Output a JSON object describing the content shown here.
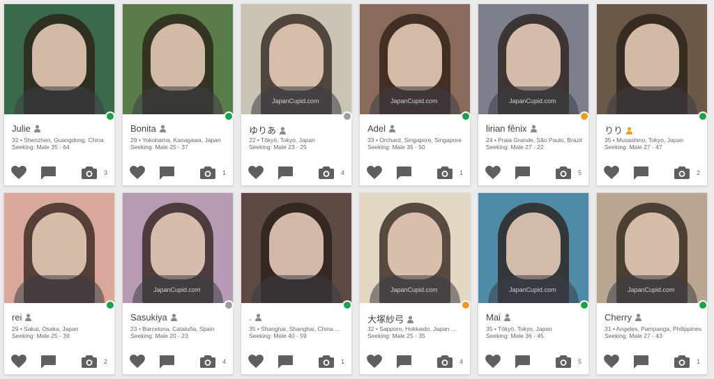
{
  "profiles": [
    {
      "name": "Julie",
      "location": "32 • Shenzhen, Guangdong, China",
      "seeking": "Seeking: Male 35 - 64",
      "photos": "3",
      "status": "online",
      "verified": false,
      "bg": "#3b6a4a",
      "watermark": ""
    },
    {
      "name": "Bonita",
      "location": "29 • Yokohama, Kanagawa, Japan",
      "seeking": "Seeking: Male 25 - 37",
      "photos": "1",
      "status": "online",
      "verified": false,
      "bg": "#5a7c48",
      "watermark": ""
    },
    {
      "name": "ゆりあ",
      "location": "22 • Tōkyō, Tokyo, Japan",
      "seeking": "Seeking: Male 23 - 25",
      "photos": "4",
      "status": "offline",
      "verified": false,
      "bg": "#c9c4b4",
      "watermark": "JapanCupid.com"
    },
    {
      "name": "Adel",
      "location": "33 • Orchard, Singapore, Singapore",
      "seeking": "Seeking: Male 35 - 50",
      "photos": "1",
      "status": "online",
      "verified": false,
      "bg": "#8a6a5a",
      "watermark": "JapanCupid.com"
    },
    {
      "name": "lirian fênix",
      "location": "24 • Praia Grande, São Paulo, Brazil",
      "seeking": "Seeking: Male 27 - 22",
      "photos": "5",
      "status": "away",
      "verified": false,
      "bg": "#7d7f8c",
      "watermark": "JapanCupid.com"
    },
    {
      "name": "りり",
      "location": "35 • Musashino, Tokyo, Japan",
      "seeking": "Seeking: Male 27 - 47",
      "photos": "2",
      "status": "online",
      "verified": true,
      "bg": "#6a5848",
      "watermark": ""
    },
    {
      "name": "rei",
      "location": "29 • Sakai, Osaka, Japan",
      "seeking": "Seeking: Male 25 - 39",
      "photos": "2",
      "status": "online",
      "verified": false,
      "bg": "#d9a89a",
      "watermark": ""
    },
    {
      "name": "Sasukiya",
      "location": "23 • Barcelona, Cataluña, Spain",
      "seeking": "Seeking: Male 20 - 23",
      "photos": "4",
      "status": "offline",
      "verified": false,
      "bg": "#b79ab4",
      "watermark": "JapanCupid.com"
    },
    {
      "name": ".",
      "location": "35 • Shanghai, Shanghai, China ...",
      "seeking": "Seeking: Male 40 - 59",
      "photos": "1",
      "status": "online",
      "verified": false,
      "bg": "#5d4a44",
      "watermark": ""
    },
    {
      "name": "大塚紗弓",
      "location": "32 • Sapporo, Hokkaido, Japan ...",
      "seeking": "Seeking: Male 25 - 35",
      "photos": "4",
      "status": "away",
      "verified": false,
      "bg": "#e3d7c4",
      "watermark": "JapanCupid.com"
    },
    {
      "name": "Mai",
      "location": "35 • Tōkyō, Tokyo, Japan",
      "seeking": "Seeking: Male 36 - 45",
      "photos": "5",
      "status": "online",
      "verified": false,
      "bg": "#4f8aa6",
      "watermark": "JapanCupid.com"
    },
    {
      "name": "Cherry",
      "location": "31 • Angeles, Pampanga, Philippines",
      "seeking": "Seeking: Male 27 - 43",
      "photos": "1",
      "status": "online",
      "verified": false,
      "bg": "#b8a690",
      "watermark": "JapanCupid.com"
    }
  ],
  "colors": {
    "online": "#1aa34a",
    "offline": "#9e9e9e",
    "away": "#f29a1f",
    "icon": "#5f5f5f",
    "verified": "#e8a020"
  }
}
